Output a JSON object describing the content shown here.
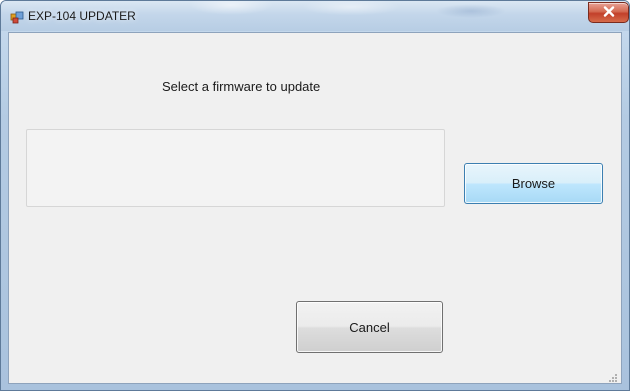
{
  "window": {
    "title": "EXP-104 UPDATER",
    "icon": "app-icon",
    "close_icon": "close-icon"
  },
  "dialog": {
    "prompt": "Select a firmware to update",
    "file_path_value": "",
    "browse_label": "Browse",
    "cancel_label": "Cancel"
  },
  "colors": {
    "titlebar": "#c3d6ea",
    "close_button": "#c2402a",
    "client_background": "#f0f0f0",
    "browse_border": "#3c7fb1"
  }
}
